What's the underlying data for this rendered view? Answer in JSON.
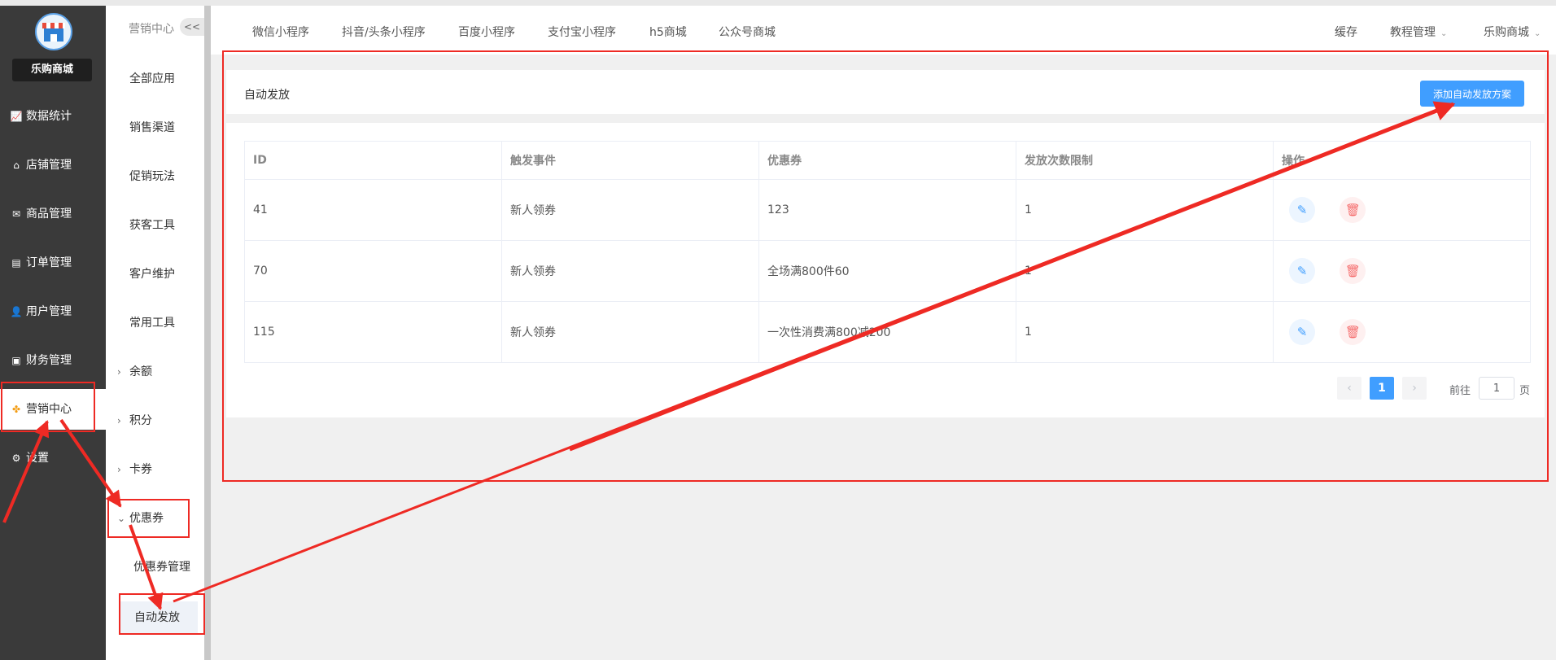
{
  "sidebar": {
    "brand": "乐购商城",
    "items": [
      {
        "label": "数据统计",
        "icon": "line-chart-icon",
        "glyph": "📈"
      },
      {
        "label": "店铺管理",
        "icon": "store-icon",
        "glyph": "⌂"
      },
      {
        "label": "商品管理",
        "icon": "envelope-icon",
        "glyph": "✉"
      },
      {
        "label": "订单管理",
        "icon": "clipboard-icon",
        "glyph": "▤"
      },
      {
        "label": "用户管理",
        "icon": "user-icon",
        "glyph": "👤"
      },
      {
        "label": "财务管理",
        "icon": "archive-icon",
        "glyph": "▣"
      },
      {
        "label": "营销中心",
        "icon": "marketing-icon",
        "glyph": "✤"
      },
      {
        "label": "设置",
        "icon": "gear-icon",
        "glyph": "⚙"
      }
    ]
  },
  "submenu": {
    "header": "营销中心",
    "collapse_label": "<<",
    "items": [
      {
        "label": "全部应用"
      },
      {
        "label": "销售渠道"
      },
      {
        "label": "促销玩法"
      },
      {
        "label": "获客工具"
      },
      {
        "label": "客户维护"
      },
      {
        "label": "常用工具"
      },
      {
        "label": "余额",
        "chevron": "›"
      },
      {
        "label": "积分",
        "chevron": "›"
      },
      {
        "label": "卡券",
        "chevron": "›"
      },
      {
        "label": "优惠券",
        "chevron": "⌄"
      },
      {
        "label": "优惠券管理"
      },
      {
        "label": "自动发放"
      }
    ]
  },
  "topnav": {
    "tabs": [
      "微信小程序",
      "抖音/头条小程序",
      "百度小程序",
      "支付宝小程序",
      "h5商城",
      "公众号商城"
    ],
    "right": [
      {
        "label": "缓存"
      },
      {
        "label": "教程管理",
        "caret": "⌄"
      },
      {
        "label": "乐购商城",
        "caret": "⌄"
      }
    ]
  },
  "page": {
    "title": "自动发放",
    "add_button": "添加自动发放方案"
  },
  "table": {
    "headers": [
      "ID",
      "触发事件",
      "优惠券",
      "发放次数限制",
      "操作"
    ],
    "rows": [
      [
        "41",
        "新人领券",
        "123",
        "1"
      ],
      [
        "70",
        "新人领券",
        "全场满800件60",
        "1"
      ],
      [
        "115",
        "新人领券",
        "一次性消费满800减200",
        "1"
      ]
    ],
    "edit_glyph": "✎",
    "delete_glyph": "🗑"
  },
  "pagination": {
    "prev": "‹",
    "current": "1",
    "next": "›",
    "goto_prefix": "前往",
    "goto_value": "1",
    "goto_suffix": "页"
  },
  "colors": {
    "annotation_red": "#ee2a24",
    "primary": "#409eff",
    "sidebar_bg": "#3a3a3a"
  }
}
